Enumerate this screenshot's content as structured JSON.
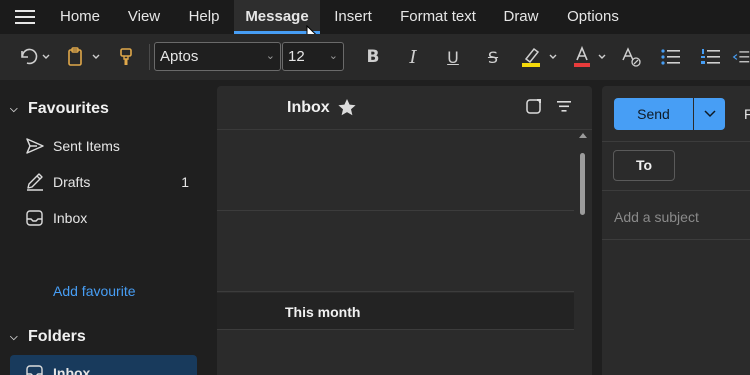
{
  "menu": {
    "tabs": [
      {
        "label": "Home"
      },
      {
        "label": "View"
      },
      {
        "label": "Help"
      },
      {
        "label": "Message"
      },
      {
        "label": "Insert"
      },
      {
        "label": "Format text"
      },
      {
        "label": "Draw"
      },
      {
        "label": "Options"
      }
    ],
    "active_tab": "Message"
  },
  "toolbar": {
    "font_name": "Aptos",
    "font_size": "12",
    "highlight_color": "#f5d90a",
    "font_color": "#e83b3b"
  },
  "nav": {
    "favourites_label": "Favourites",
    "favourites": [
      {
        "label": "Sent Items",
        "icon": "send-icon",
        "count": ""
      },
      {
        "label": "Drafts",
        "icon": "pencil-icon",
        "count": "1"
      },
      {
        "label": "Inbox",
        "icon": "inbox-icon",
        "count": ""
      }
    ],
    "add_favourite": "Add favourite",
    "folders_label": "Folders",
    "folders": [
      {
        "label": "Inbox",
        "icon": "inbox-icon",
        "selected": true
      }
    ]
  },
  "message_list": {
    "title": "Inbox",
    "group_label": "This month"
  },
  "compose": {
    "send_label": "Send",
    "clipped_label": "F",
    "to_label": "To",
    "subject_placeholder": "Add a subject"
  },
  "colors": {
    "accent": "#479ef5",
    "background": "#1f1f1f",
    "pane": "#2b2b2b",
    "selected_nav": "#183a5c"
  }
}
